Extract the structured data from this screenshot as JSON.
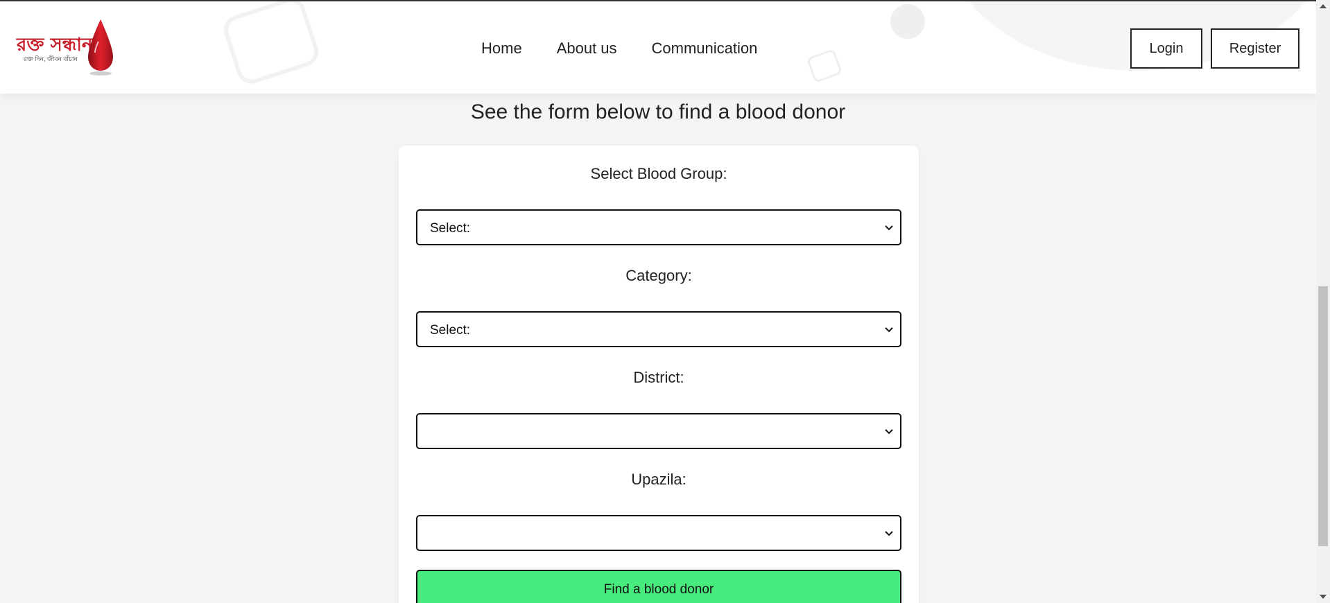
{
  "brand": {
    "name": "রক্ত সন্ধান",
    "tagline": "রক্ত দিন, জীবন বাঁচান",
    "accent_color": "#c81f2a"
  },
  "nav": {
    "items": [
      "Home",
      "About us",
      "Communication"
    ]
  },
  "auth": {
    "login_label": "Login",
    "register_label": "Register"
  },
  "main": {
    "heading": "See the form below to find a blood donor",
    "blood_group": {
      "label": "Select Blood Group:",
      "value": "Select:"
    },
    "category": {
      "label": "Category:",
      "value": "Select:"
    },
    "district": {
      "label": "District:",
      "value": ""
    },
    "upazila": {
      "label": "Upazila:",
      "value": ""
    },
    "submit_label": "Find a blood donor",
    "submit_color": "#47eb7e"
  },
  "icons": {
    "select_chevron": "chevron-down-icon",
    "logo_drop": "blood-drop-icon"
  }
}
